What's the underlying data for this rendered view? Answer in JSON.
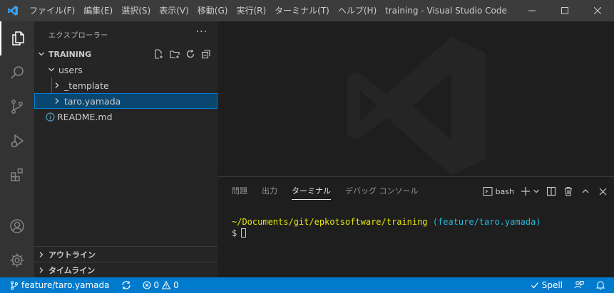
{
  "titlebar": {
    "menu": [
      {
        "label": "ファイル(F)"
      },
      {
        "label": "編集(E)"
      },
      {
        "label": "選択(S)"
      },
      {
        "label": "表示(V)"
      },
      {
        "label": "移動(G)"
      },
      {
        "label": "実行(R)"
      },
      {
        "label": "ターミナル(T)"
      },
      {
        "label": "ヘルプ(H)"
      }
    ],
    "window_title": "training - Visual Studio Code"
  },
  "sidebar": {
    "title": "エクスプローラー",
    "more": "···",
    "root": "TRAINING",
    "tree": [
      {
        "label": "users"
      },
      {
        "label": "_template"
      },
      {
        "label": "taro.yamada"
      },
      {
        "label": "README.md"
      }
    ],
    "outline": "アウトライン",
    "timeline": "タイムライン"
  },
  "panel": {
    "tabs": [
      {
        "label": "問題"
      },
      {
        "label": "出力"
      },
      {
        "label": "ターミナル"
      },
      {
        "label": "デバッグ コンソール"
      }
    ],
    "terminal_name": "bash",
    "terminal_path": "~/Documents/git/epkotsoftware/training",
    "terminal_branch": "(feature/taro.yamada)",
    "terminal_prompt": "$"
  },
  "statusbar": {
    "branch": "feature/taro.yamada",
    "errors": "0",
    "warnings": "0",
    "spell": "Spell"
  },
  "colors": {
    "accent": "#007acc",
    "selection": "#094771",
    "terminal_path": "#e5e510",
    "terminal_branch": "#29b8db"
  }
}
